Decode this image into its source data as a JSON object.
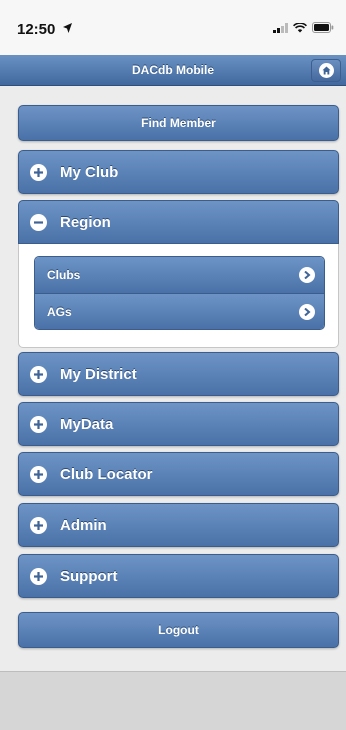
{
  "status": {
    "time": "12:50"
  },
  "header": {
    "title": "DACdb Mobile"
  },
  "menu": {
    "find_member": "Find Member",
    "my_club": "My Club",
    "region": "Region",
    "region_items": [
      "Clubs",
      "AGs"
    ],
    "my_district": "My District",
    "mydata": "MyData",
    "club_locator": "Club Locator",
    "admin": "Admin",
    "support": "Support",
    "logout": "Logout"
  },
  "colors": {
    "accent": "#5a81b5",
    "header": "#5279ad"
  }
}
